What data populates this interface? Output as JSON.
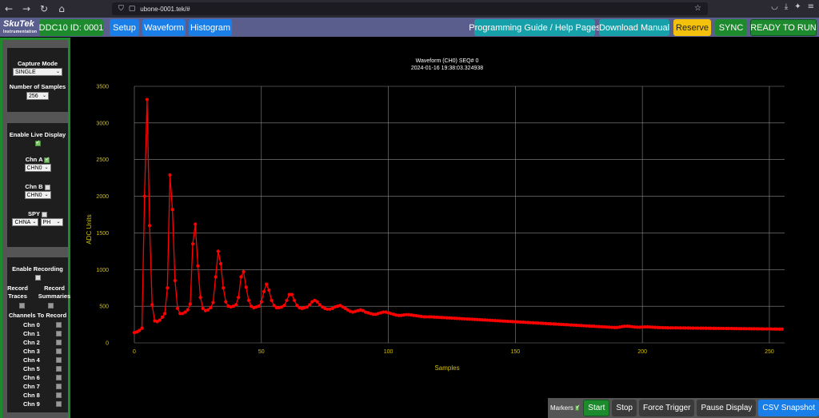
{
  "browser": {
    "url": "ubone-0001.tek/#"
  },
  "header": {
    "logo_main": "SkuTek",
    "logo_sub": "Instrumentation",
    "device_id": "DDC10 ID: 0001",
    "setup": "Setup",
    "waveform": "Waveform",
    "histogram": "Histogram",
    "programming_guide": "Programming Guide / Help Pages",
    "download_manual": "Download Manual",
    "reserve": "Reserve",
    "sync": "SYNC",
    "status": "READY TO RUN"
  },
  "sidebar": {
    "capture_mode_label": "Capture Mode",
    "capture_mode_value": "SINGLE",
    "num_samples_label": "Number of Samples",
    "num_samples_value": "256",
    "live_display_label": "Enable Live Display",
    "chn_a_label": "Chn A",
    "chn_a_value": "CHN0",
    "chn_b_label": "Chn B",
    "chn_b_value": "CHN0",
    "spy_label": "SPY",
    "spy_value": "CHNA",
    "spy_mode_value": "PH",
    "recording_label": "Enable Recording",
    "record_traces_label": "Record Traces",
    "record_summaries_label": "Record Summaries",
    "channels_label": "Channels To Record",
    "channels": [
      "Chn 0",
      "Chn 1",
      "Chn 2",
      "Chn 3",
      "Chn 4",
      "Chn 5",
      "Chn 6",
      "Chn 7",
      "Chn 8",
      "Chn 9"
    ]
  },
  "bottom": {
    "markers": "Markers",
    "start": "Start",
    "stop": "Stop",
    "force_trigger": "Force Trigger",
    "pause_display": "Pause Display",
    "csv_snapshot": "CSV Snapshot"
  },
  "colors": {
    "series": "#ff0000",
    "axis_text": "#d4c000",
    "grid": "#8a8a8a"
  },
  "chart_data": {
    "type": "line",
    "title": "Waveform (CH0) SEQ# 0",
    "subtitle": "2024-01-16 19:38:03.324938",
    "xlabel": "Samples",
    "ylabel": "ADC Units",
    "xlim": [
      0,
      256
    ],
    "ylim": [
      0,
      3500
    ],
    "xticks": [
      0,
      50,
      100,
      150,
      200,
      250
    ],
    "yticks": [
      0,
      500,
      1000,
      1500,
      2000,
      2500,
      3000,
      3500
    ],
    "grid": true,
    "markers": true,
    "points": [
      [
        0,
        140
      ],
      [
        1,
        150
      ],
      [
        2,
        170
      ],
      [
        3,
        200
      ],
      [
        4,
        2000
      ],
      [
        5,
        3320
      ],
      [
        6,
        1600
      ],
      [
        7,
        520
      ],
      [
        8,
        300
      ],
      [
        9,
        290
      ],
      [
        10,
        310
      ],
      [
        11,
        350
      ],
      [
        12,
        400
      ],
      [
        13,
        750
      ],
      [
        14,
        2290
      ],
      [
        15,
        1820
      ],
      [
        16,
        850
      ],
      [
        17,
        470
      ],
      [
        18,
        400
      ],
      [
        19,
        400
      ],
      [
        20,
        420
      ],
      [
        21,
        450
      ],
      [
        22,
        530
      ],
      [
        23,
        1350
      ],
      [
        24,
        1620
      ],
      [
        25,
        1050
      ],
      [
        26,
        620
      ],
      [
        27,
        470
      ],
      [
        28,
        440
      ],
      [
        29,
        450
      ],
      [
        30,
        480
      ],
      [
        31,
        550
      ],
      [
        32,
        900
      ],
      [
        33,
        1250
      ],
      [
        34,
        1080
      ],
      [
        35,
        750
      ],
      [
        36,
        560
      ],
      [
        37,
        500
      ],
      [
        38,
        490
      ],
      [
        39,
        500
      ],
      [
        40,
        520
      ],
      [
        41,
        620
      ],
      [
        42,
        900
      ],
      [
        43,
        970
      ],
      [
        44,
        760
      ],
      [
        45,
        580
      ],
      [
        46,
        500
      ],
      [
        47,
        480
      ],
      [
        48,
        490
      ],
      [
        49,
        500
      ],
      [
        50,
        560
      ],
      [
        51,
        700
      ],
      [
        52,
        800
      ],
      [
        53,
        720
      ],
      [
        54,
        580
      ],
      [
        55,
        510
      ],
      [
        56,
        480
      ],
      [
        57,
        480
      ],
      [
        58,
        490
      ],
      [
        59,
        510
      ],
      [
        60,
        580
      ],
      [
        61,
        660
      ],
      [
        62,
        660
      ],
      [
        63,
        580
      ],
      [
        64,
        510
      ],
      [
        65,
        480
      ],
      [
        66,
        470
      ],
      [
        67,
        480
      ],
      [
        68,
        490
      ],
      [
        69,
        520
      ],
      [
        70,
        560
      ],
      [
        71,
        580
      ],
      [
        72,
        560
      ],
      [
        73,
        520
      ],
      [
        74,
        490
      ],
      [
        75,
        470
      ],
      [
        76,
        460
      ],
      [
        77,
        460
      ],
      [
        78,
        470
      ],
      [
        79,
        490
      ],
      [
        80,
        500
      ],
      [
        81,
        510
      ],
      [
        82,
        490
      ],
      [
        83,
        470
      ],
      [
        84,
        450
      ],
      [
        85,
        430
      ],
      [
        86,
        420
      ],
      [
        87,
        430
      ],
      [
        88,
        440
      ],
      [
        89,
        450
      ],
      [
        90,
        440
      ],
      [
        91,
        420
      ],
      [
        92,
        410
      ],
      [
        93,
        400
      ],
      [
        94,
        390
      ],
      [
        95,
        390
      ],
      [
        96,
        400
      ],
      [
        97,
        410
      ],
      [
        98,
        420
      ],
      [
        99,
        420
      ],
      [
        100,
        410
      ],
      [
        101,
        400
      ],
      [
        102,
        390
      ],
      [
        103,
        380
      ],
      [
        104,
        375
      ],
      [
        105,
        375
      ],
      [
        106,
        380
      ],
      [
        107,
        385
      ],
      [
        108,
        385
      ],
      [
        109,
        380
      ],
      [
        110,
        375
      ],
      [
        111,
        370
      ],
      [
        112,
        365
      ],
      [
        113,
        360
      ],
      [
        114,
        355
      ],
      [
        115,
        355
      ],
      [
        116,
        355
      ],
      [
        117,
        355
      ],
      [
        118,
        352
      ],
      [
        119,
        350
      ],
      [
        120,
        348
      ],
      [
        121,
        346
      ],
      [
        122,
        344
      ],
      [
        123,
        342
      ],
      [
        124,
        340
      ],
      [
        125,
        338
      ],
      [
        126,
        336
      ],
      [
        127,
        334
      ],
      [
        128,
        332
      ],
      [
        129,
        330
      ],
      [
        130,
        328
      ],
      [
        131,
        326
      ],
      [
        132,
        324
      ],
      [
        133,
        322
      ],
      [
        134,
        320
      ],
      [
        135,
        318
      ],
      [
        136,
        316
      ],
      [
        137,
        314
      ],
      [
        138,
        312
      ],
      [
        139,
        310
      ],
      [
        140,
        308
      ],
      [
        141,
        306
      ],
      [
        142,
        304
      ],
      [
        143,
        302
      ],
      [
        144,
        300
      ],
      [
        145,
        298
      ],
      [
        146,
        296
      ],
      [
        147,
        294
      ],
      [
        148,
        292
      ],
      [
        149,
        290
      ],
      [
        150,
        288
      ],
      [
        151,
        286
      ],
      [
        152,
        284
      ],
      [
        153,
        282
      ],
      [
        154,
        280
      ],
      [
        155,
        278
      ],
      [
        156,
        276
      ],
      [
        157,
        274
      ],
      [
        158,
        272
      ],
      [
        159,
        270
      ],
      [
        160,
        268
      ],
      [
        161,
        266
      ],
      [
        162,
        264
      ],
      [
        163,
        262
      ],
      [
        164,
        260
      ],
      [
        165,
        258
      ],
      [
        166,
        256
      ],
      [
        167,
        254
      ],
      [
        168,
        252
      ],
      [
        169,
        250
      ],
      [
        170,
        248
      ],
      [
        171,
        246
      ],
      [
        172,
        244
      ],
      [
        173,
        242
      ],
      [
        174,
        240
      ],
      [
        175,
        238
      ],
      [
        176,
        236
      ],
      [
        177,
        234
      ],
      [
        178,
        232
      ],
      [
        179,
        230
      ],
      [
        180,
        228
      ],
      [
        181,
        226
      ],
      [
        182,
        224
      ],
      [
        183,
        222
      ],
      [
        184,
        220
      ],
      [
        185,
        218
      ],
      [
        186,
        216
      ],
      [
        187,
        214
      ],
      [
        188,
        212
      ],
      [
        189,
        210
      ],
      [
        190,
        210
      ],
      [
        191,
        215
      ],
      [
        192,
        222
      ],
      [
        193,
        226
      ],
      [
        194,
        228
      ],
      [
        195,
        225
      ],
      [
        196,
        220
      ],
      [
        197,
        216
      ],
      [
        198,
        214
      ],
      [
        199,
        214
      ],
      [
        200,
        216
      ],
      [
        201,
        218
      ],
      [
        202,
        218
      ],
      [
        203,
        216
      ],
      [
        204,
        214
      ],
      [
        205,
        212
      ],
      [
        206,
        210
      ],
      [
        207,
        209
      ],
      [
        208,
        208
      ],
      [
        209,
        207
      ],
      [
        210,
        206
      ],
      [
        211,
        205
      ],
      [
        212,
        205
      ],
      [
        213,
        205
      ],
      [
        214,
        205
      ],
      [
        215,
        204
      ],
      [
        216,
        204
      ],
      [
        217,
        203
      ],
      [
        218,
        203
      ],
      [
        219,
        202
      ],
      [
        220,
        202
      ],
      [
        221,
        201
      ],
      [
        222,
        201
      ],
      [
        223,
        200
      ],
      [
        224,
        200
      ],
      [
        225,
        200
      ],
      [
        226,
        199
      ],
      [
        227,
        199
      ],
      [
        228,
        198
      ],
      [
        229,
        198
      ],
      [
        230,
        198
      ],
      [
        231,
        197
      ],
      [
        232,
        197
      ],
      [
        233,
        196
      ],
      [
        234,
        196
      ],
      [
        235,
        196
      ],
      [
        236,
        195
      ],
      [
        237,
        195
      ],
      [
        238,
        194
      ],
      [
        239,
        194
      ],
      [
        240,
        194
      ],
      [
        241,
        193
      ],
      [
        242,
        193
      ],
      [
        243,
        192
      ],
      [
        244,
        192
      ],
      [
        245,
        192
      ],
      [
        246,
        191
      ],
      [
        247,
        191
      ],
      [
        248,
        190
      ],
      [
        249,
        190
      ],
      [
        250,
        190
      ],
      [
        251,
        189
      ],
      [
        252,
        189
      ],
      [
        253,
        188
      ],
      [
        254,
        188
      ],
      [
        255,
        188
      ]
    ]
  }
}
